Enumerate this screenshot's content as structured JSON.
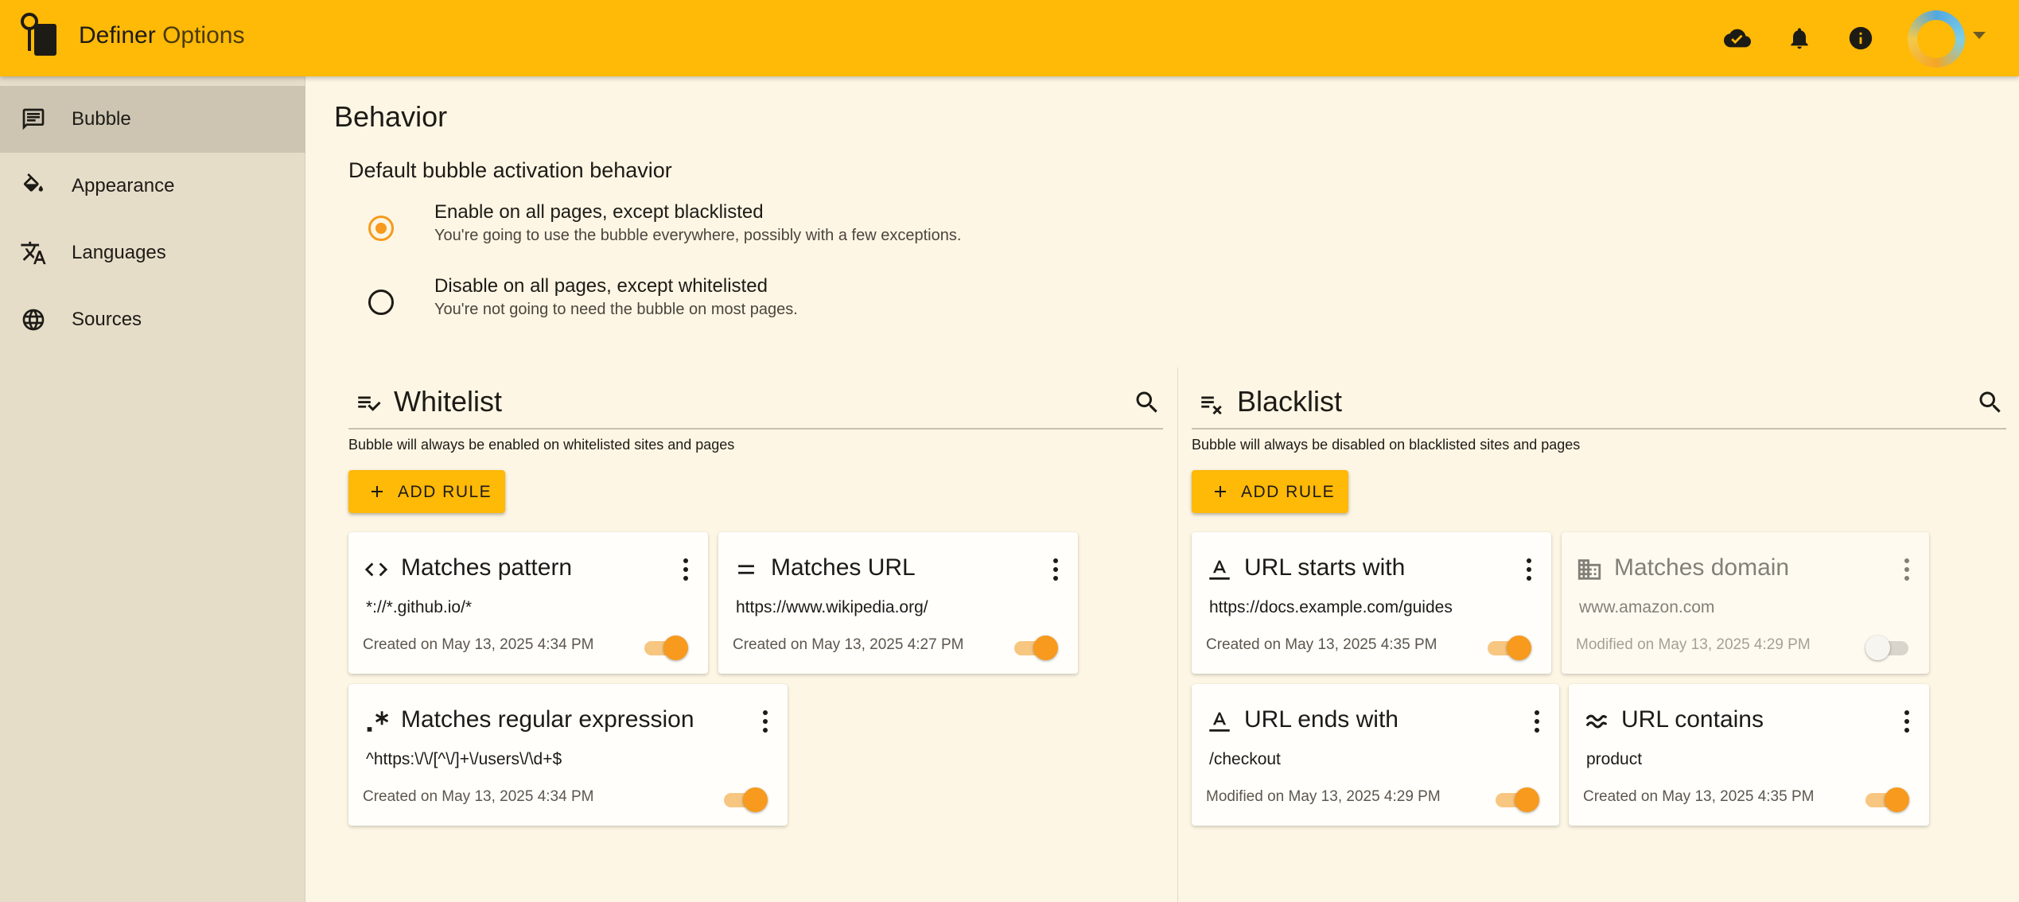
{
  "app": {
    "title_main": "Definer",
    "title_sub": "Options"
  },
  "header_icons": [
    "cloud-done-icon",
    "bell-icon",
    "info-icon"
  ],
  "sidebar": {
    "items": [
      {
        "label": "Bubble",
        "icon": "chat-bubble-icon",
        "active": true
      },
      {
        "label": "Appearance",
        "icon": "paint-bucket-icon",
        "active": false
      },
      {
        "label": "Languages",
        "icon": "translate-icon",
        "active": false
      },
      {
        "label": "Sources",
        "icon": "globe-icon",
        "active": false
      }
    ]
  },
  "main": {
    "page_title": "Behavior",
    "section_title": "Default bubble activation behavior",
    "options": [
      {
        "label": "Enable on all pages, except blacklisted",
        "desc": "You're going to use the bubble everywhere, possibly with a few exceptions.",
        "checked": true
      },
      {
        "label": "Disable on all pages, except whitelisted",
        "desc": "You're not going to need the bubble on most pages.",
        "checked": false
      }
    ]
  },
  "whitelist": {
    "title": "Whitelist",
    "desc": "Bubble will always be enabled on whitelisted sites and pages",
    "add_label": "ADD RULE",
    "rules": [
      {
        "icon": "code-icon",
        "title": "Matches pattern",
        "value": "*://*.github.io/*",
        "date": "Created on May 13, 2025 4:34 PM",
        "enabled": true
      },
      {
        "icon": "equals-icon",
        "title": "Matches URL",
        "value": "https://www.wikipedia.org/",
        "date": "Created on May 13, 2025 4:27 PM",
        "enabled": true
      },
      {
        "icon": "regex-icon",
        "title": "Matches regular expression",
        "value": "^https:\\/\\/[^\\/]+\\/users\\/\\d+$",
        "date": "Created on May 13, 2025 4:34 PM",
        "enabled": true
      }
    ]
  },
  "blacklist": {
    "title": "Blacklist",
    "desc": "Bubble will always be disabled on blacklisted sites and pages",
    "add_label": "ADD RULE",
    "rules": [
      {
        "icon": "text-start-icon",
        "title": "URL starts with",
        "value": "https://docs.example.com/guides",
        "date": "Created on May 13, 2025 4:35 PM",
        "enabled": true
      },
      {
        "icon": "domain-icon",
        "title": "Matches domain",
        "value": "www.amazon.com",
        "date": "Modified on May 13, 2025 4:29 PM",
        "enabled": false
      },
      {
        "icon": "text-end-icon",
        "title": "URL ends with",
        "value": "/checkout",
        "date": "Modified on May 13, 2025 4:29 PM",
        "enabled": true
      },
      {
        "icon": "approx-icon",
        "title": "URL contains",
        "value": "product",
        "date": "Created on May 13, 2025 4:35 PM",
        "enabled": true
      }
    ]
  },
  "colors": {
    "primary": "#ffb907",
    "accent": "#f79a1e",
    "background": "#fef6e4",
    "sidebar": "#e6ddc9"
  }
}
